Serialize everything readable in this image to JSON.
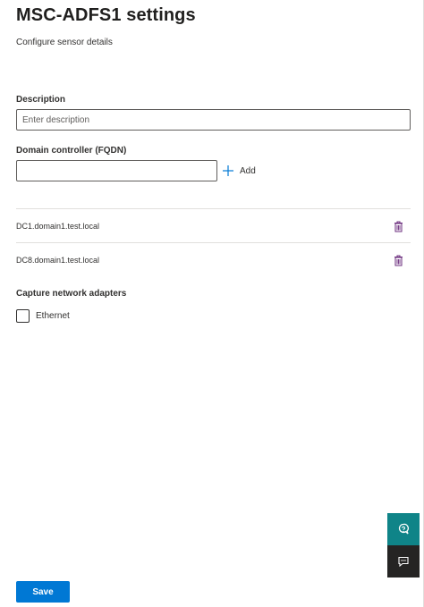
{
  "header": {
    "title": "MSC-ADFS1 settings",
    "subtitle": "Configure sensor details"
  },
  "description": {
    "label": "Description",
    "placeholder": "Enter description",
    "value": ""
  },
  "domain_controller": {
    "label": "Domain controller (FQDN)",
    "value": "",
    "add_label": "Add",
    "items": [
      {
        "name": "DC1.domain1.test.local",
        "action_icon": "trash-icon"
      },
      {
        "name": "DC8.domain1.test.local",
        "action_icon": "trash-icon"
      }
    ]
  },
  "network_adapters": {
    "label": "Capture network adapters",
    "options": [
      {
        "label": "Ethernet",
        "checked": false
      }
    ]
  },
  "floating": {
    "help_icon": "help-chat-icon",
    "feedback_icon": "feedback-icon"
  },
  "footer": {
    "save_label": "Save"
  },
  "colors": {
    "accent": "#0078d4",
    "help_button": "#0f8488",
    "feedback_button": "#252423",
    "trash_icon": "#6b2d7d"
  }
}
